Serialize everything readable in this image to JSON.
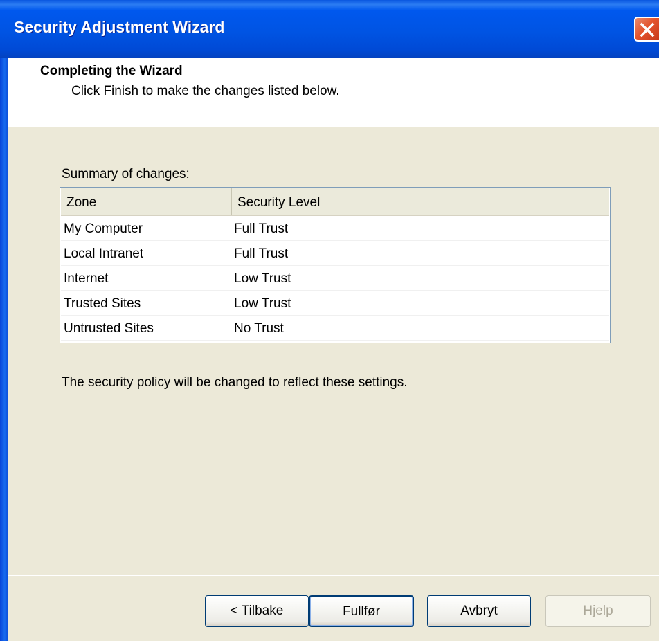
{
  "window": {
    "title": "Security Adjustment Wizard"
  },
  "header": {
    "title": "Completing the Wizard",
    "subtitle": "Click Finish to make the changes listed below."
  },
  "summary": {
    "label": "Summary of changes:",
    "columns": [
      "Zone",
      "Security Level"
    ],
    "rows": [
      [
        "My Computer",
        "Full Trust"
      ],
      [
        "Local Intranet",
        "Full Trust"
      ],
      [
        "Internet",
        "Low Trust"
      ],
      [
        "Trusted Sites",
        "Low Trust"
      ],
      [
        "Untrusted Sites",
        "No Trust"
      ]
    ]
  },
  "policy_text": "The security policy will be changed to reflect these settings.",
  "buttons": {
    "back": "< Tilbake",
    "finish": "Fullfør",
    "cancel": "Avbryt",
    "help": "Hjelp"
  },
  "colors": {
    "titlebar": "#0054e3",
    "dialog_bg": "#ece9d8",
    "close_button": "#e3542d"
  }
}
